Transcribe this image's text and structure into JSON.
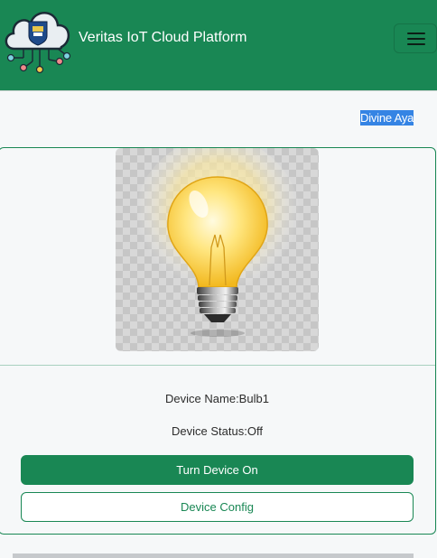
{
  "header": {
    "brand": "Veritas IoT Cloud Platform",
    "logo_icon": "cloud-circuit-logo-icon",
    "menu_icon": "hamburger-menu-icon"
  },
  "user": {
    "name": "Divine Aya"
  },
  "device": {
    "image_icon": "lightbulb-icon",
    "name_text": "Device Name:Bulb1",
    "status_text": "Device Status:Off"
  },
  "actions": {
    "turn_on_label": "Turn Device On",
    "config_label": "Device Config"
  },
  "colors": {
    "brand_green": "#198754",
    "highlight_blue": "#3584e4",
    "page_bg": "#f6f8f9"
  }
}
